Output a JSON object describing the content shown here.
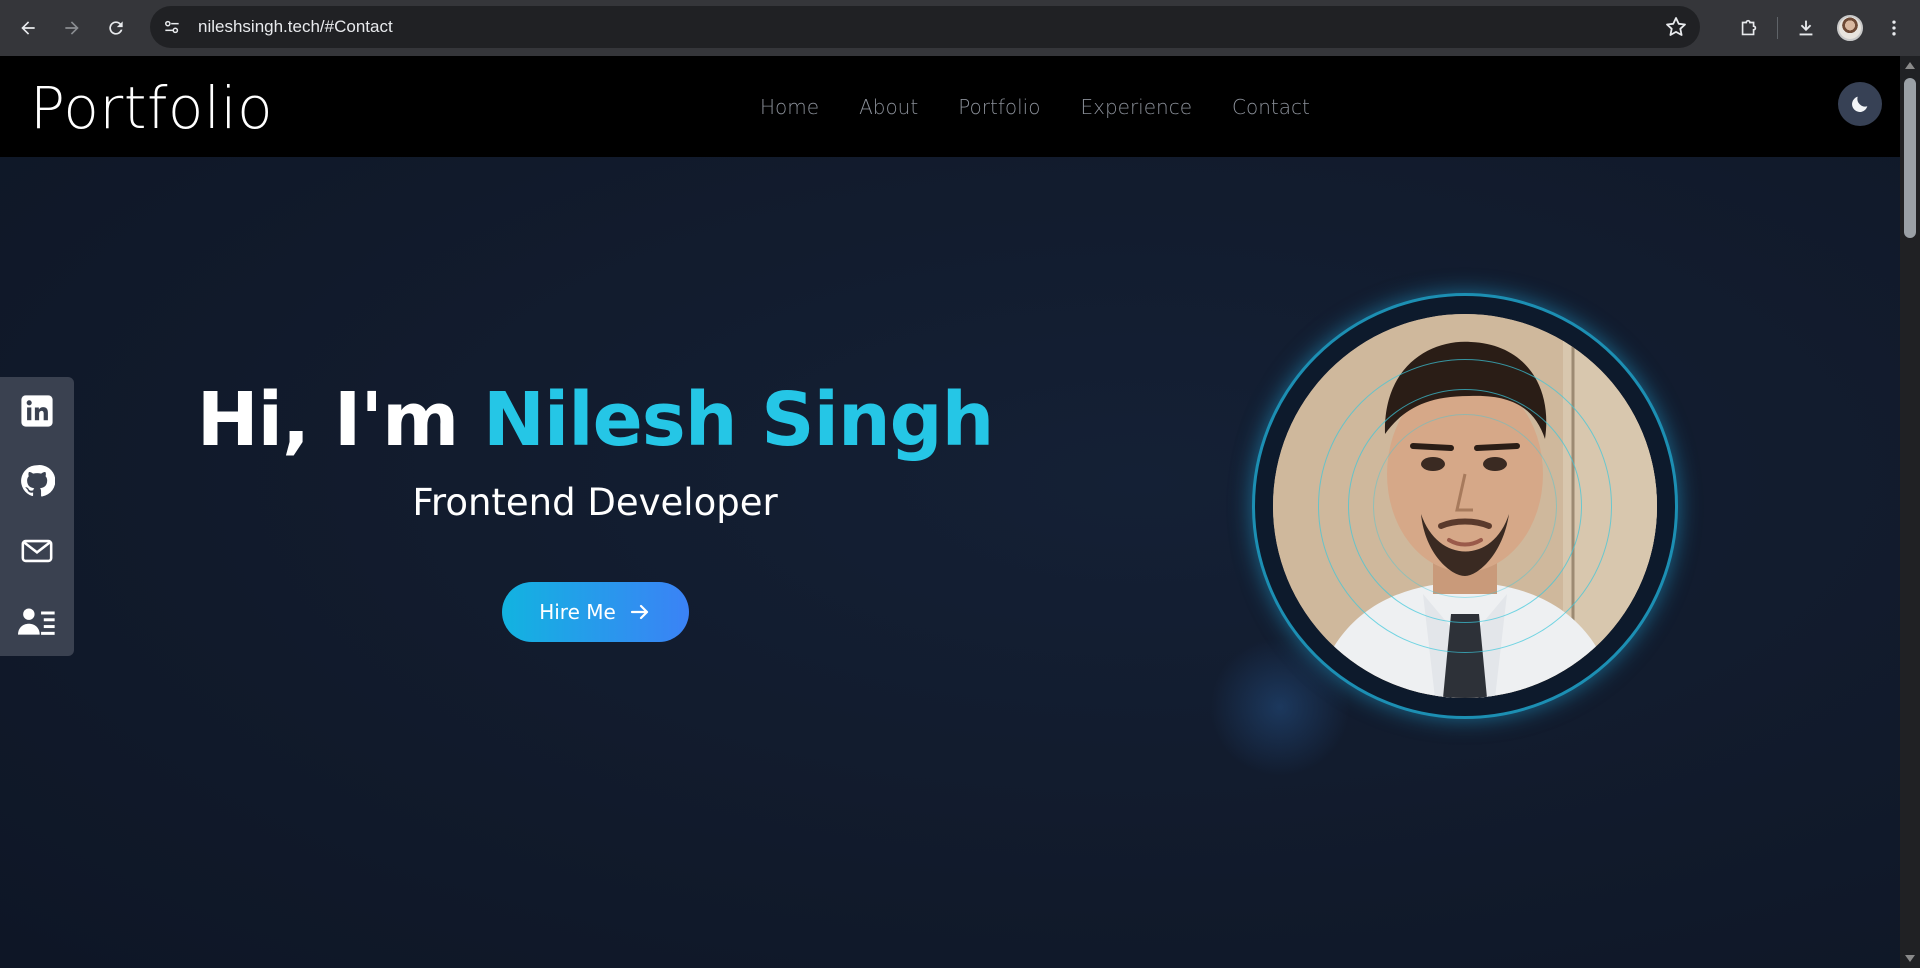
{
  "browser": {
    "url": "nileshsingh.tech/#Contact",
    "back_icon": "arrow-left-icon",
    "forward_icon": "arrow-right-icon",
    "reload_icon": "reload-icon",
    "bookmark_icon": "star-icon",
    "extensions_icon": "puzzle-icon",
    "downloads_icon": "download-icon",
    "menu_icon": "kebab-menu-icon"
  },
  "site": {
    "brand": "Portfolio",
    "nav": [
      "Home",
      "About",
      "Portfolio",
      "Experience",
      "Contact"
    ],
    "theme_toggle_icon": "moon-icon"
  },
  "hero": {
    "greeting": "Hi, I'm ",
    "name": "Nilesh Singh",
    "role": "Frontend Developer",
    "cta_label": "Hire Me",
    "cta_icon": "arrow-right-icon",
    "accent_color": "#25c6e6"
  },
  "social": [
    {
      "icon": "linkedin-icon"
    },
    {
      "icon": "github-icon"
    },
    {
      "icon": "mail-icon"
    },
    {
      "icon": "resume-icon"
    }
  ],
  "colors": {
    "header_bg": "#000000",
    "hero_bg": "#111a2b",
    "button_gradient_start": "#12b3e0",
    "button_gradient_end": "#3b82f6"
  }
}
